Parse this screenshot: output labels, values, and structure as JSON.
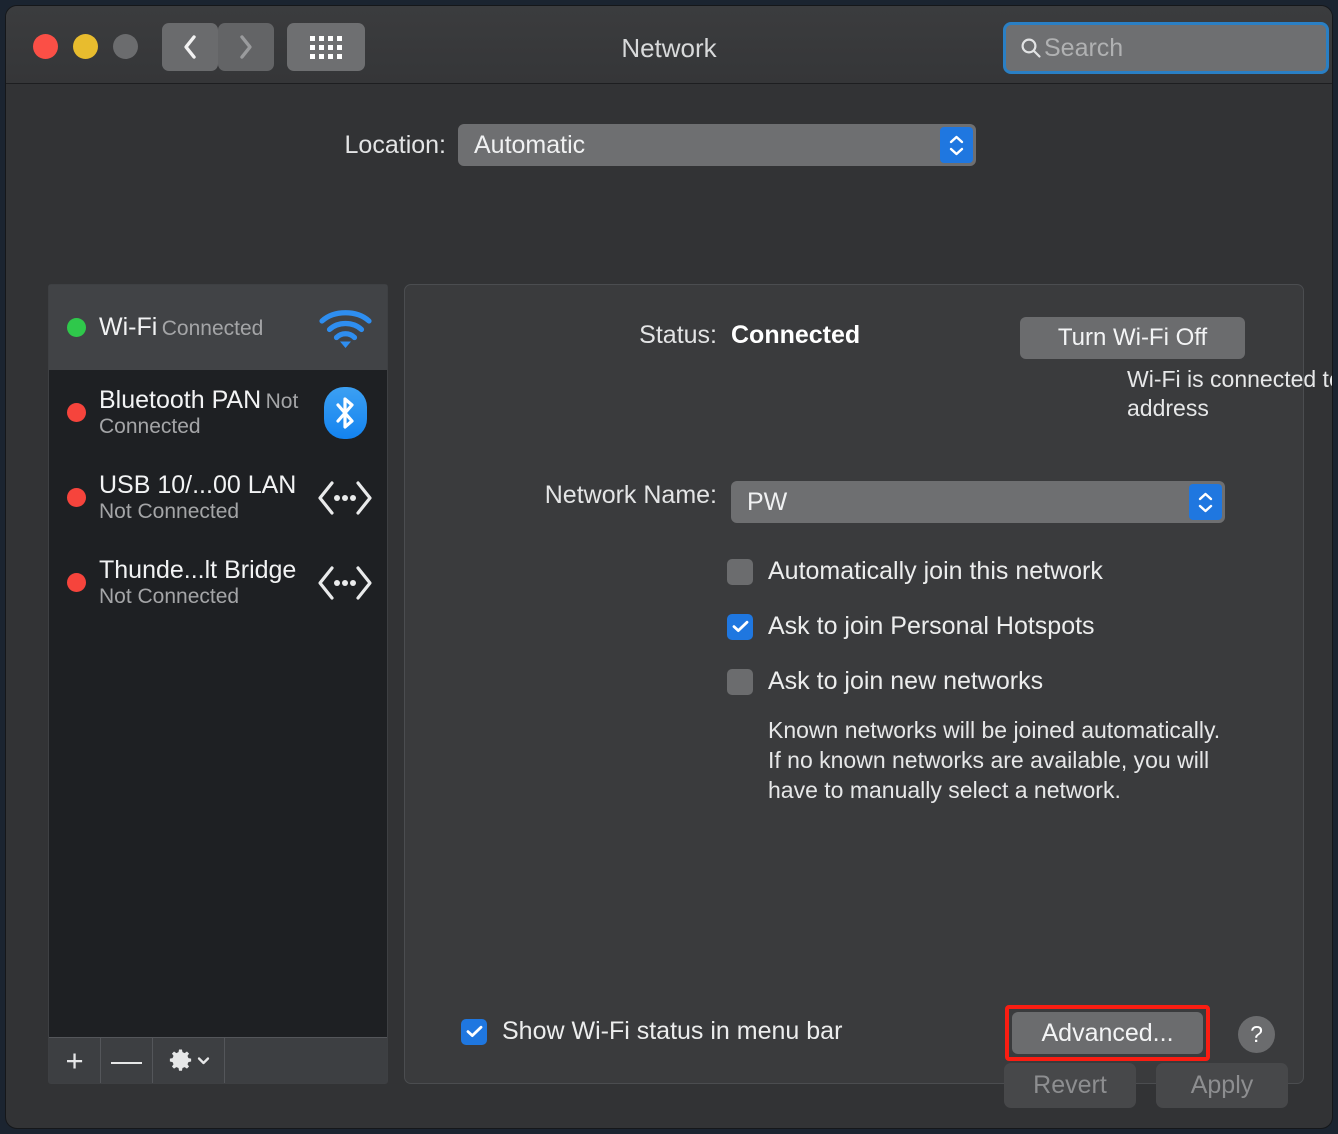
{
  "window": {
    "title": "Network",
    "traffic_lights": {
      "close": "close",
      "minimize": "minimize",
      "zoom": "zoom"
    },
    "nav": {
      "back": "back",
      "forward": "forward",
      "grid": "show-all-preferences"
    }
  },
  "search": {
    "placeholder": "Search",
    "value": "",
    "icon": "search-icon"
  },
  "location": {
    "label": "Location:",
    "value": "Automatic"
  },
  "sidebar": {
    "interfaces": [
      {
        "name": "Wi-Fi",
        "status": "Connected",
        "dot": "green",
        "icon": "wifi-icon",
        "selected": true
      },
      {
        "name": "Bluetooth PAN",
        "status": "Not Connected",
        "dot": "red",
        "icon": "bluetooth-icon",
        "selected": false
      },
      {
        "name": "USB 10/...00 LAN",
        "status": "Not Connected",
        "dot": "red",
        "icon": "ethernet-icon",
        "selected": false
      },
      {
        "name": "Thunde...lt Bridge",
        "status": "Not Connected",
        "dot": "red",
        "icon": "ethernet-icon",
        "selected": false
      }
    ],
    "footer": {
      "add": "+",
      "remove": "—",
      "actions_icon": "gear-icon"
    }
  },
  "detail": {
    "status_label": "Status:",
    "status_value": "Connected",
    "toggle_button": "Turn Wi-Fi Off",
    "status_description": "Wi-Fi is connected to PW and has the IP address",
    "network_name_label": "Network Name:",
    "network_name_value": "PW",
    "checkboxes": [
      {
        "label": "Automatically join this network",
        "checked": false
      },
      {
        "label": "Ask to join Personal Hotspots",
        "checked": true
      },
      {
        "label": "Ask to join new networks",
        "checked": false
      }
    ],
    "note": "Known networks will be joined automatically. If no known networks are available, you will have to manually select a network.",
    "show_status": {
      "label": "Show Wi-Fi status in menu bar",
      "checked": true
    },
    "advanced_button": "Advanced...",
    "help_button": "?"
  },
  "footer": {
    "revert": "Revert",
    "apply": "Apply"
  },
  "colors": {
    "accent_blue": "#1f77e0",
    "focus_ring": "#2a7fc4",
    "highlight_red": "#fa1d12",
    "connected_green": "#2fc84b",
    "disconnected_red": "#f6443c"
  }
}
